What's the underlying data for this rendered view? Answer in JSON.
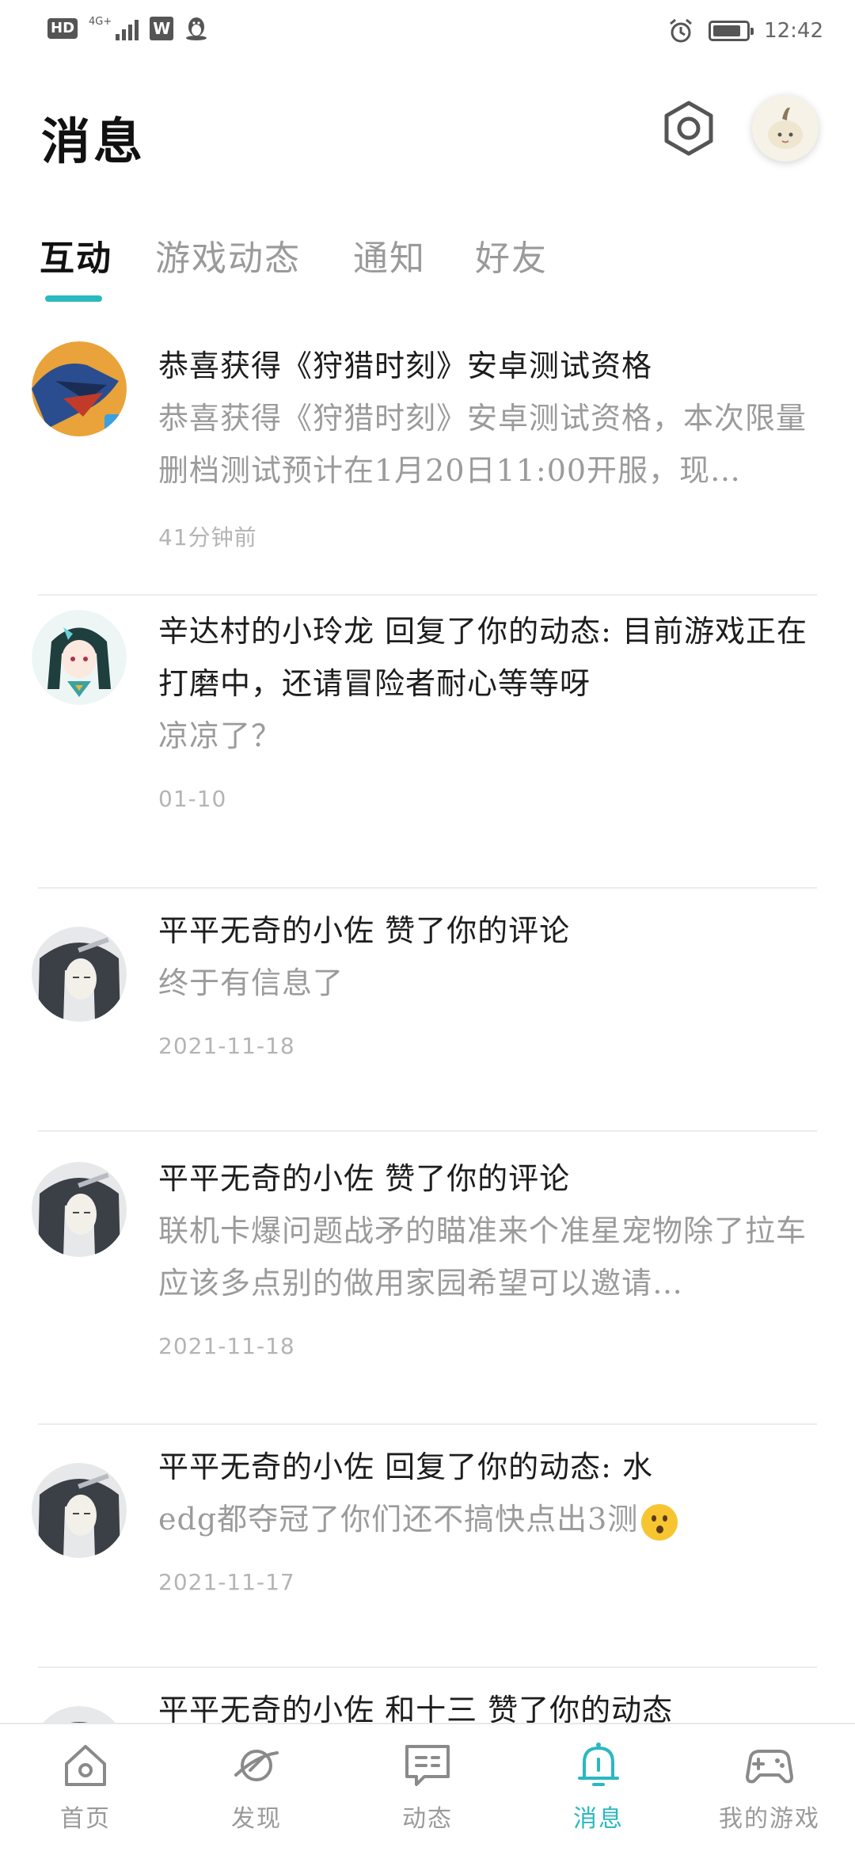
{
  "status_bar": {
    "hd_label": "HD",
    "network_label": "4G+",
    "app_w_label": "W",
    "time": "12:42",
    "battery_level": 0.85
  },
  "header": {
    "title": "消息",
    "settings_icon": "hexagon-settings-icon",
    "avatar_icon": "user-avatar"
  },
  "tabs": [
    {
      "label": "互动",
      "active": true
    },
    {
      "label": "游戏动态",
      "active": false
    },
    {
      "label": "通知",
      "active": false
    },
    {
      "label": "好友",
      "active": false
    }
  ],
  "messages": [
    {
      "title": "恭喜获得《狩猎时刻》安卓测试资格",
      "body": "恭喜获得《狩猎时刻》安卓测试资格，本次限量删档测试预计在1月20日11:00开服，现…",
      "time": "41分钟前",
      "avatar": "game-dragon-avatar"
    },
    {
      "title": "辛达村的小玲龙 回复了你的动态: 目前游戏正在打磨中，还请冒险者耐心等等呀",
      "body": "凉凉了？",
      "time": "01-10",
      "avatar": "girl-avatar"
    },
    {
      "title": "平平无奇的小佐 赞了你的评论",
      "body": "终于有信息了",
      "time": "2021-11-18",
      "avatar": "swordsman-avatar"
    },
    {
      "title": "平平无奇的小佐 赞了你的评论",
      "body": "联机卡爆问题战矛的瞄准来个准星宠物除了拉车应该多点别的做用家园希望可以邀请…",
      "time": "2021-11-18",
      "avatar": "swordsman-avatar"
    },
    {
      "title": "平平无奇的小佐 回复了你的动态: 水",
      "body": "edg都夺冠了你们还不搞快点出3测",
      "time": "2021-11-17",
      "avatar": "swordsman-avatar"
    },
    {
      "title": "平平无奇的小佐 和十三 赞了你的动态",
      "body": "",
      "time": "",
      "avatar": "swordsman-avatar"
    }
  ],
  "bottom_nav": [
    {
      "label": "首页",
      "icon": "home-icon",
      "active": false
    },
    {
      "label": "发现",
      "icon": "planet-icon",
      "active": false
    },
    {
      "label": "动态",
      "icon": "chat-icon",
      "active": false
    },
    {
      "label": "消息",
      "icon": "bell-icon",
      "active": true
    },
    {
      "label": "我的游戏",
      "icon": "gamepad-icon",
      "active": false
    }
  ],
  "colors": {
    "accent": "#2bb8c0",
    "text_primary": "#1d1d1d",
    "text_secondary": "#9b9b9b",
    "divider": "#ececec"
  }
}
